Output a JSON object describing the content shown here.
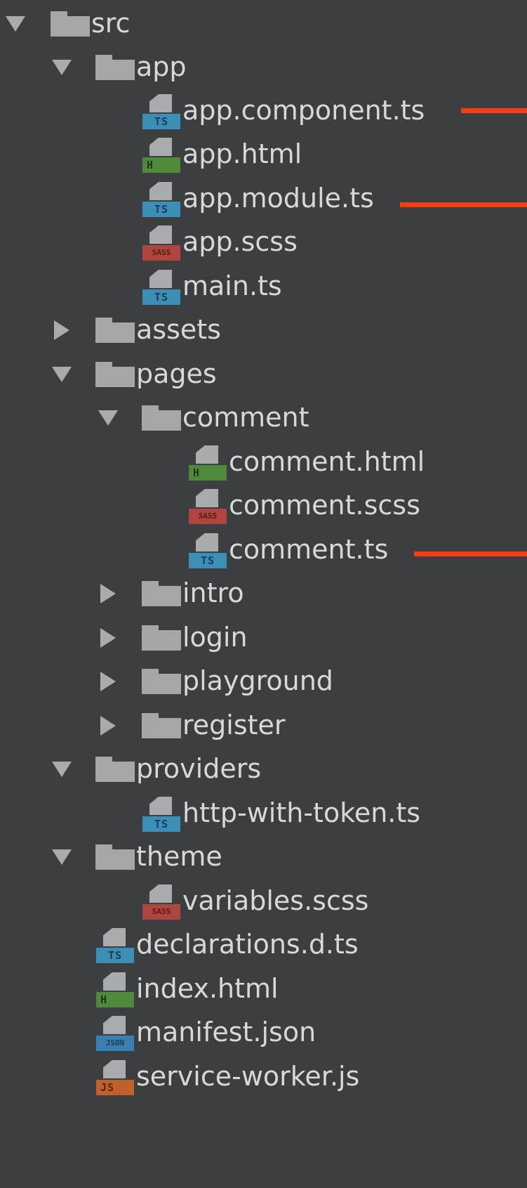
{
  "tree": {
    "src": "src",
    "app": "app",
    "app_component": "app.component.ts",
    "app_html": "app.html",
    "app_module": "app.module.ts",
    "app_scss": "app.scss",
    "main_ts": "main.ts",
    "assets": "assets",
    "pages": "pages",
    "comment": "comment",
    "comment_html": "comment.html",
    "comment_scss": "comment.scss",
    "comment_ts": "comment.ts",
    "intro": "intro",
    "login": "login",
    "playground": "playground",
    "register": "register",
    "providers": "providers",
    "http_with_token": "http-with-token.ts",
    "theme": "theme",
    "variables_scss": "variables.scss",
    "declarations": "declarations.d.ts",
    "index_html": "index.html",
    "manifest": "manifest.json",
    "service_worker": "service-worker.js"
  },
  "tags": {
    "ts": "TS",
    "h": "H",
    "sass": "SASS",
    "json": "JSON",
    "js": "JS"
  },
  "colors": {
    "background": "#3c3f41",
    "text": "#d6d8da",
    "ts": "#3b8fb6",
    "html": "#4f8a3a",
    "sass": "#b0443f",
    "json": "#3b7fb0",
    "js": "#c2602a",
    "annotation": "#ff3b14"
  }
}
